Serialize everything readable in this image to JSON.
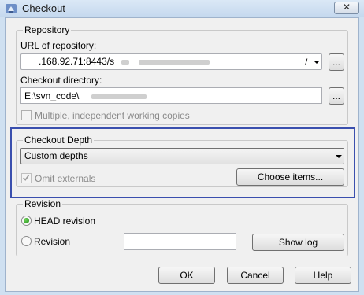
{
  "window": {
    "title": "Checkout"
  },
  "repository": {
    "group_title": "Repository",
    "url_label": "URL of repository:",
    "url_value": ".168.92.71:8443/s",
    "url_tail": "/",
    "browse_label": "...",
    "dir_label": "Checkout directory:",
    "dir_value": "E:\\svn_code\\",
    "dir_browse_label": "...",
    "multiple_label": "Multiple, independent working copies"
  },
  "depth": {
    "group_title": "Checkout Depth",
    "selected": "Custom depths",
    "omit_label": "Omit externals",
    "omit_checked": true,
    "choose_label": "Choose items..."
  },
  "revision": {
    "group_title": "Revision",
    "head_label": "HEAD revision",
    "rev_label": "Revision",
    "rev_value": "",
    "show_log_label": "Show log"
  },
  "buttons": {
    "ok": "OK",
    "cancel": "Cancel",
    "help": "Help"
  },
  "colors": {
    "highlight": "#3a4fae",
    "radio_selected": "#1e8a12"
  }
}
